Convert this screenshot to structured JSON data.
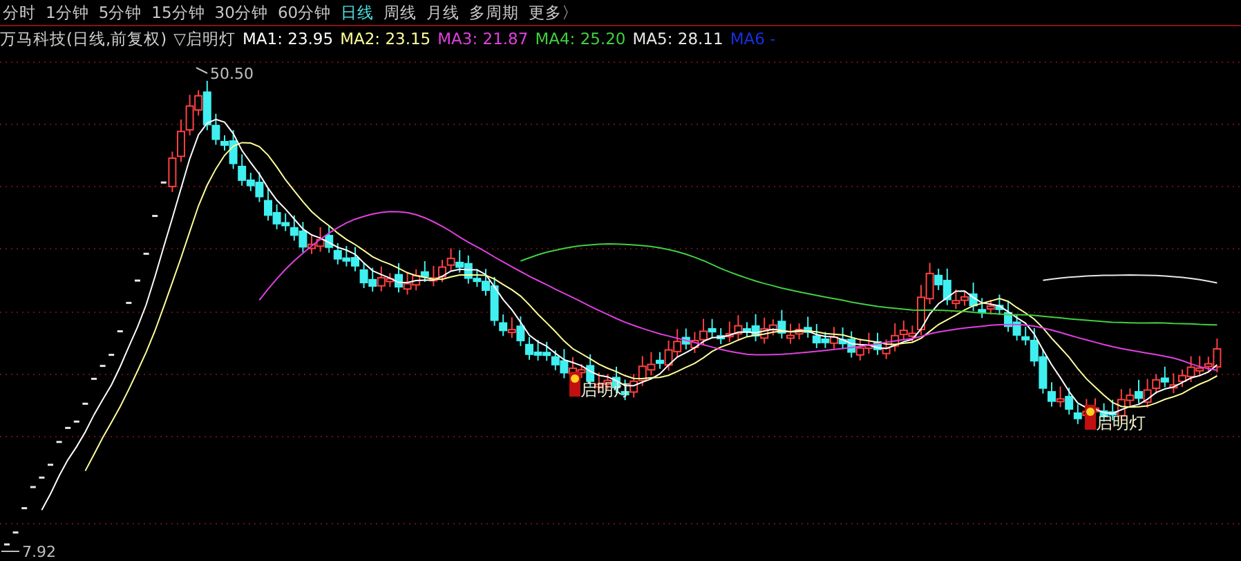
{
  "periods": [
    {
      "label": "分时",
      "selected": false
    },
    {
      "label": "1分钟",
      "selected": false
    },
    {
      "label": "5分钟",
      "selected": false
    },
    {
      "label": "15分钟",
      "selected": false
    },
    {
      "label": "30分钟",
      "selected": false
    },
    {
      "label": "60分钟",
      "selected": false
    },
    {
      "label": "日线",
      "selected": true
    },
    {
      "label": "周线",
      "selected": false
    },
    {
      "label": "月线",
      "selected": false
    },
    {
      "label": "多周期",
      "selected": false
    },
    {
      "label": "更多〉",
      "selected": false
    }
  ],
  "title": {
    "stock": "万马科技(日线,前复权)",
    "indicator": "▽启明灯"
  },
  "ma": [
    {
      "name": "MA1:",
      "value": "23.95",
      "color": "#ffffff"
    },
    {
      "name": "MA2:",
      "value": "23.15",
      "color": "#ffff99"
    },
    {
      "name": "MA3:",
      "value": "21.87",
      "color": "#e040e0"
    },
    {
      "name": "MA4:",
      "value": "25.20",
      "color": "#40d040"
    },
    {
      "name": "MA5:",
      "value": "28.11",
      "color": "#e8e8e8"
    },
    {
      "name": "MA6",
      "value": "-",
      "color": "#1830e0"
    }
  ],
  "chart": {
    "high_label": "50.50",
    "low_label": "7.92",
    "signals": [
      {
        "label": "启明灯"
      },
      {
        "label": "启明灯"
      }
    ]
  }
}
